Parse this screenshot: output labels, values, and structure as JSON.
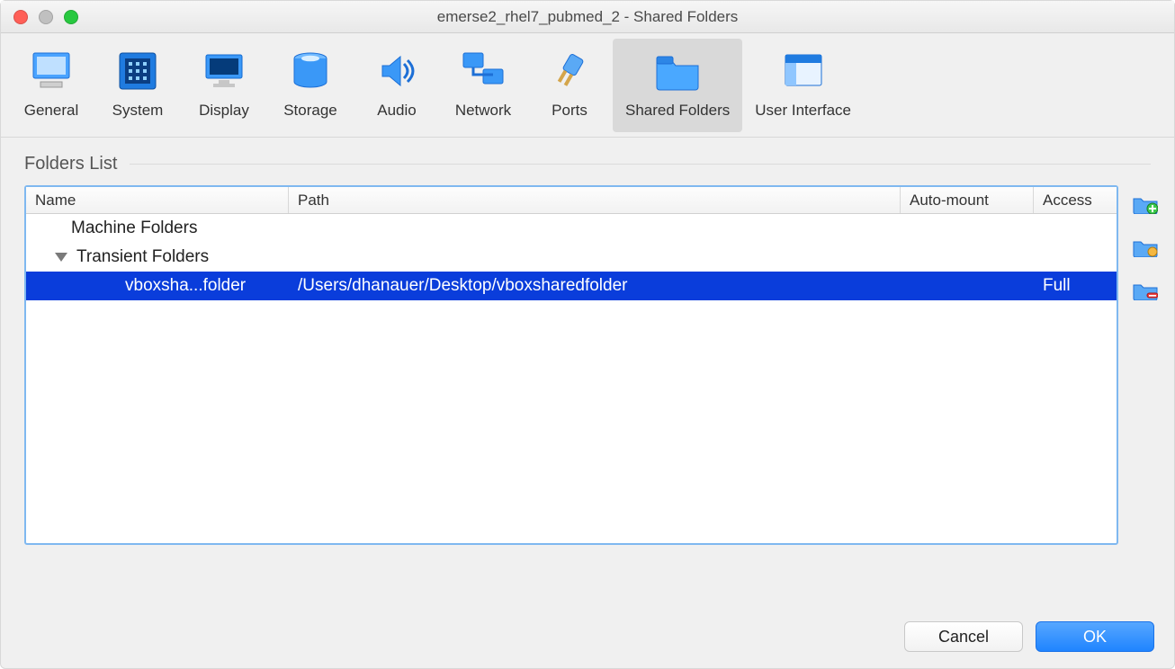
{
  "window": {
    "title": "emerse2_rhel7_pubmed_2 - Shared Folders"
  },
  "toolbar": {
    "items": [
      {
        "id": "general",
        "label": "General"
      },
      {
        "id": "system",
        "label": "System"
      },
      {
        "id": "display",
        "label": "Display"
      },
      {
        "id": "storage",
        "label": "Storage"
      },
      {
        "id": "audio",
        "label": "Audio"
      },
      {
        "id": "network",
        "label": "Network"
      },
      {
        "id": "ports",
        "label": "Ports"
      },
      {
        "id": "shared-folders",
        "label": "Shared Folders",
        "selected": true
      },
      {
        "id": "user-interface",
        "label": "User Interface"
      }
    ]
  },
  "section": {
    "title": "Folders List"
  },
  "table": {
    "columns": {
      "name": "Name",
      "path": "Path",
      "mount": "Auto-mount",
      "access": "Access"
    },
    "groups": [
      {
        "label": "Machine Folders",
        "expanded": false,
        "rows": []
      },
      {
        "label": "Transient Folders",
        "expanded": true,
        "rows": [
          {
            "name": "vboxsha...folder",
            "path": "/Users/dhanauer/Desktop/vboxsharedfolder",
            "mount": "",
            "access": "Full",
            "selected": true
          }
        ]
      }
    ]
  },
  "side_actions": {
    "add": "add-folder",
    "edit": "edit-folder",
    "remove": "remove-folder"
  },
  "buttons": {
    "cancel": "Cancel",
    "ok": "OK"
  }
}
